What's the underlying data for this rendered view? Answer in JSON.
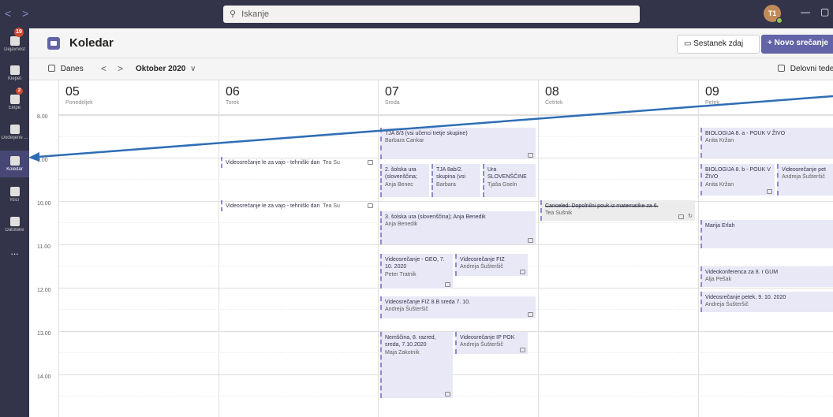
{
  "topbar": {
    "back": "<",
    "forward": ">",
    "search_placeholder": "Iskanje",
    "avatar_initials": "T1",
    "minimize": "—",
    "maximize": "▢"
  },
  "rail": {
    "items": [
      {
        "label": "Dejavnost",
        "badge": "19",
        "icon": "bell-icon"
      },
      {
        "label": "Klepet",
        "badge": "",
        "icon": "chat-icon"
      },
      {
        "label": "Ekipe",
        "badge": "2",
        "icon": "teams-icon"
      },
      {
        "label": "Dodeljene ...",
        "badge": "",
        "icon": "assignments-icon"
      },
      {
        "label": "Koledar",
        "badge": "",
        "icon": "calendar-icon"
      },
      {
        "label": "Klici",
        "badge": "",
        "icon": "phone-icon"
      },
      {
        "label": "Datoteke",
        "badge": "",
        "icon": "files-icon"
      },
      {
        "label": "...",
        "badge": "",
        "icon": "more-icon"
      }
    ]
  },
  "header": {
    "title": "Koledar",
    "meet_now": "Sestanek zdaj",
    "new_meeting": "+ Novo srečanje"
  },
  "toolbar": {
    "today": "Danes",
    "prev": "<",
    "next": ">",
    "month": "Oktober 2020",
    "view": "Delovni teden"
  },
  "days": [
    {
      "num": "05",
      "name": "Ponedeljek"
    },
    {
      "num": "06",
      "name": "Torek"
    },
    {
      "num": "07",
      "name": "Sreda"
    },
    {
      "num": "08",
      "name": "Četrtek"
    },
    {
      "num": "09",
      "name": "Petek"
    }
  ],
  "times": [
    "8.00",
    "9.00",
    "10.00",
    "11.00",
    "12.00",
    "13.00",
    "14.00"
  ],
  "events": {
    "tue1": {
      "title": "Videosrečanje le za vajo - tehniški dan",
      "org": "Tea Su"
    },
    "tue2": {
      "title": "Videosrečanje le za vajo - tehniški dan",
      "org": "Tea Su"
    },
    "wed1": {
      "title": "TJA 8/3 (vsi učenci tretje skupine)",
      "org": "Barbara Cankar"
    },
    "wed2": {
      "title": "2. šolska ura (slovenščina;",
      "org": "Anja Benec"
    },
    "wed3": {
      "title": "TJA 8ab/2. skupina (vsi",
      "org": "Barbara"
    },
    "wed4": {
      "title": "Ura SLOVENŠČINE",
      "org": "Tjaša Gseln"
    },
    "wed5": {
      "title": "3. šolska ura (slovenščina); Anja Benedik",
      "org": "Anja Benedik"
    },
    "wed6": {
      "title": "Videosrečanje - GEO, 7. 10. 2020",
      "org": "Peter Tratnik"
    },
    "wed7": {
      "title": "Videosrečanje FIZ",
      "org": "Andreja Šušteršič"
    },
    "wed8": {
      "title": "Videosrečanje FIZ 8.B sreda 7. 10.",
      "org": "Andreja Šušteršič"
    },
    "wed9": {
      "title": "Nemščina, 8. razred, sreda, 7.10.2020",
      "org": "Maja Zakotnik"
    },
    "wed10": {
      "title": "Videosrečanje IP POK",
      "org": "Andreja Šušteršič"
    },
    "thu1": {
      "title": "Canceled: Dopolnilni pouk iz matematike za 6.",
      "org": "Tea Sušnik"
    },
    "fri1": {
      "title": "BIOLOGIJA 8. a - POUK V ŽIVO",
      "org": "Anita Kržan"
    },
    "fri2": {
      "title": "BIOLOGIJA 8. b - POUK V ŽIVO",
      "org": "Anita Kržan"
    },
    "fri3": {
      "title": "Videosrečanje pet",
      "org": "Andreja Šušteršič"
    },
    "fri4": {
      "title": "",
      "org": "Marija Erlah"
    },
    "fri5": {
      "title": "Videokonferenca za 8. r GUM",
      "org": "Alja Pešak"
    },
    "fri6": {
      "title": "Videosrečanje petek, 9. 10. 2020",
      "org": "Andreja Šušteršič"
    }
  },
  "colors": {
    "topbar": "#33344a",
    "accent": "#6264a7",
    "event_bg": "#e8e8f7",
    "annotation": "#2e6eb5"
  }
}
